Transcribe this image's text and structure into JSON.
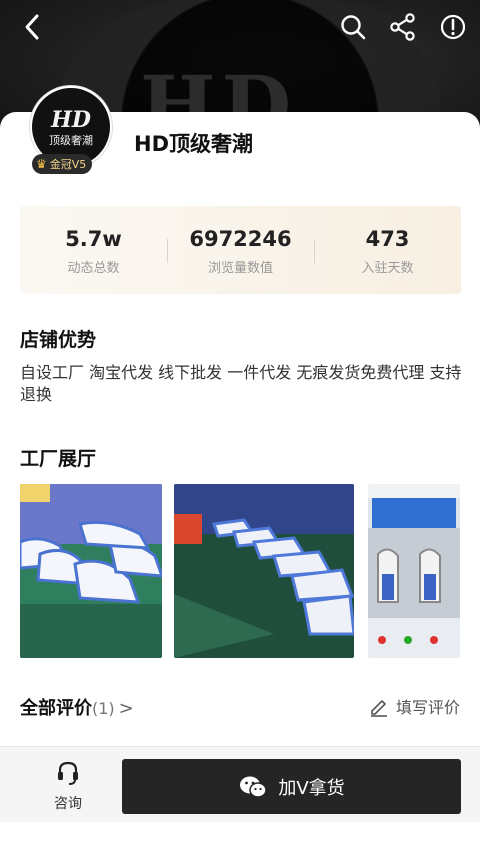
{
  "header": {
    "back_icon": "chevron-left-icon",
    "actions": [
      "search-icon",
      "share-icon",
      "info-icon"
    ]
  },
  "shop": {
    "name": "HD顶级奢潮",
    "avatar_text_top": "HD",
    "avatar_text_bottom": "顶级奢潮",
    "badge": "金冠V5"
  },
  "stats": [
    {
      "value": "5.7w",
      "label": "动态总数"
    },
    {
      "value": "6972246",
      "label": "浏览量数值"
    },
    {
      "value": "473",
      "label": "入驻天数"
    }
  ],
  "advantages": {
    "title": "店铺优势",
    "text": " 自设工厂 淘宝代发 线下批发 一件代发 无痕发货免费代理 支持退换"
  },
  "factory": {
    "title": "工厂展厅",
    "photos": [
      "sneakers-display-photo",
      "sneakers-production-line-photo",
      "factory-machine-photo"
    ]
  },
  "reviews": {
    "title": "全部评价",
    "count": "(1)",
    "chevron": ">",
    "write_label": "填写评价"
  },
  "bottom": {
    "consult_label": "咨询",
    "add_v_label": "加V拿货"
  },
  "colors": {
    "banner": "#1e1e1e",
    "stats_bg": "#f7efe2",
    "button_dark": "#252525",
    "badge_gold": "#f4d48a"
  }
}
